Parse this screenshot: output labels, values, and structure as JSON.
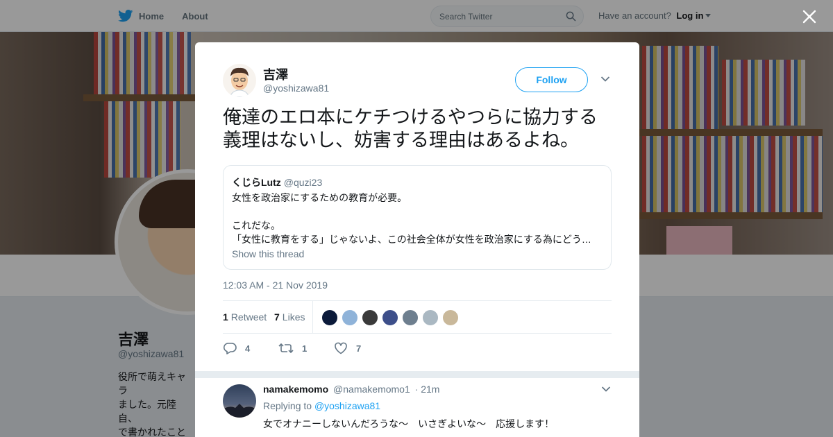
{
  "nav": {
    "home": "Home",
    "about": "About",
    "search_placeholder": "Search Twitter",
    "have_account": "Have an account?",
    "login": "Log in"
  },
  "profile": {
    "name": "吉澤",
    "handle": "@yoshizawa81",
    "bio_fragment": "役所で萌えキャラ\nました。元陸自、\nで書かれたことは\nりません。いいね\n味しません。避難"
  },
  "tweet": {
    "author_name": "吉澤",
    "author_handle": "@yoshizawa81",
    "follow_label": "Follow",
    "text": "俺達のエロ本にケチつけるやつらに協力する義理はないし、妨害する理由はあるよね。",
    "timestamp": "12:03 AM - 21 Nov 2019",
    "retweet_count": "1",
    "retweet_label": "Retweet",
    "like_count": "7",
    "like_label": "Likes",
    "replies_action": "4",
    "retweets_action": "1",
    "likes_action": "7"
  },
  "quote": {
    "name": "くじらLutz",
    "handle": "@quzi23",
    "line1": "女性を政治家にするための教育が必要。",
    "line2": "これだな。",
    "line3": "「女性に教育をする」じゃないよ、この社会全体が女性を政治家にする為にどう…",
    "show_thread": "Show this thread"
  },
  "likers_colors": [
    "#0b1a3a",
    "#8fb3d9",
    "#3a3a3a",
    "#3d4f8a",
    "#6e7f8f",
    "#aab8c2",
    "#c9b89a"
  ],
  "reply": {
    "name": "namakemomo",
    "handle": "@namakemomo1",
    "time": "· 21m",
    "replying_label": "Replying to",
    "replying_to": "@yoshizawa81",
    "text": "女でオナニーしないんだろうな～　いさぎよいな～　応援します！"
  },
  "colors": {
    "accent": "#1da1f2",
    "muted": "#657786",
    "text": "#14171a"
  }
}
